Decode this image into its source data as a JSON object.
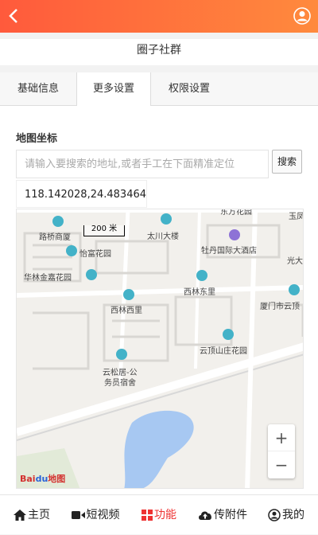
{
  "header": {
    "back_icon": "chevron-left-icon",
    "user_icon": "user-circle-icon",
    "gradient_start": "#ff5a3c",
    "gradient_end": "#ff8a3d"
  },
  "page_title": "圈子社群",
  "tabs": [
    {
      "label": "基础信息"
    },
    {
      "label": "更多设置"
    },
    {
      "label": "权限设置"
    }
  ],
  "form": {
    "map_label": "地图坐标",
    "search_placeholder": "请输入要搜索的地址,或者手工在下面精准定位",
    "search_button": "搜索",
    "coordinate_value": "118.142028,24.483464"
  },
  "map": {
    "scale_label": "200 米",
    "pois": [
      {
        "name": "路桥商厦"
      },
      {
        "name": "太川大楼"
      },
      {
        "name": "怡富花园"
      },
      {
        "name": "牡丹国际大酒店"
      },
      {
        "name": "华林金嘉花园"
      },
      {
        "name": "西林东里"
      },
      {
        "name": "西林西里"
      },
      {
        "name": "厦门市云顶"
      },
      {
        "name": "云顶山庄花园"
      },
      {
        "name": "云松居-公"
      },
      {
        "name": "务员宿舍"
      },
      {
        "name": "玉凤"
      },
      {
        "name": "光大"
      },
      {
        "name": "东方花园"
      }
    ],
    "zoom_in": "+",
    "zoom_out": "−",
    "brand_bai": "Bai",
    "brand_du": "du",
    "brand_map": "地图"
  },
  "bottom_nav": [
    {
      "label": "主页",
      "icon": "home-icon"
    },
    {
      "label": "短视频",
      "icon": "video-icon"
    },
    {
      "label": "功能",
      "icon": "grid-icon"
    },
    {
      "label": "传附件",
      "icon": "cloud-upload-icon"
    },
    {
      "label": "我的",
      "icon": "user-icon"
    }
  ],
  "colors": {
    "active_nav": "#ee3333",
    "poi_icon": "#43b2c8",
    "water": "#a7c8f2"
  }
}
